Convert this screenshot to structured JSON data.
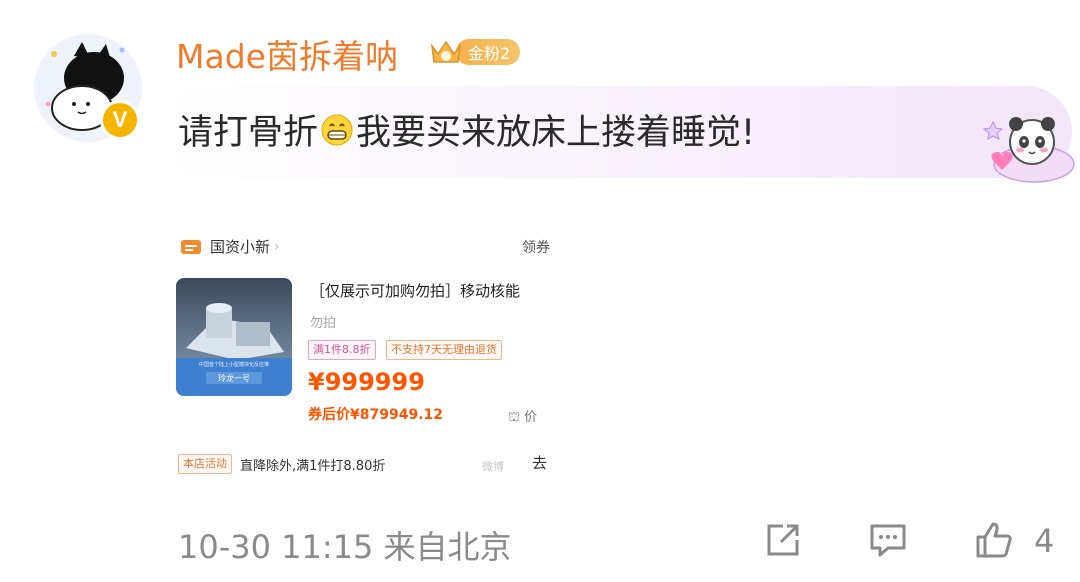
{
  "user": {
    "name": "Made茵拆着呐",
    "fan_badge": "金粉2",
    "verified_mark": "V"
  },
  "comment": {
    "text_before": "请打骨折",
    "emoji": "grinning-face-emoji",
    "text_after": "我要买来放床上搂着睡觉!"
  },
  "product_card": {
    "shop_name": "国资小新",
    "shop_arrow": "›",
    "coupon_label": "领券",
    "thumb_caption": "中国首个陆上小型模块化反应堆",
    "thumb_name": "玲龙一号",
    "title": "［仅展示可加购勿拍］移动核能",
    "subtitle": "勿拍",
    "tag_discount": "满1件8.8折",
    "tag_no_return": "不支持7天无理由退货",
    "price": "¥999999",
    "price_after_coupon": "券后价¥879949.12",
    "compare_label": "价",
    "promo_tag": "本店活动",
    "promo_text": "直降除外,满1件打8.80折",
    "watermark": "微博",
    "truncated_char": "去"
  },
  "footer": {
    "timestamp": "10-30 11:15",
    "location": "来自北京",
    "like_count": "4"
  },
  "colors": {
    "username": "#ef7c2a",
    "price": "#ff5500",
    "meta_gray": "#8a8a8a",
    "badge_gold": "#f6b14d"
  }
}
